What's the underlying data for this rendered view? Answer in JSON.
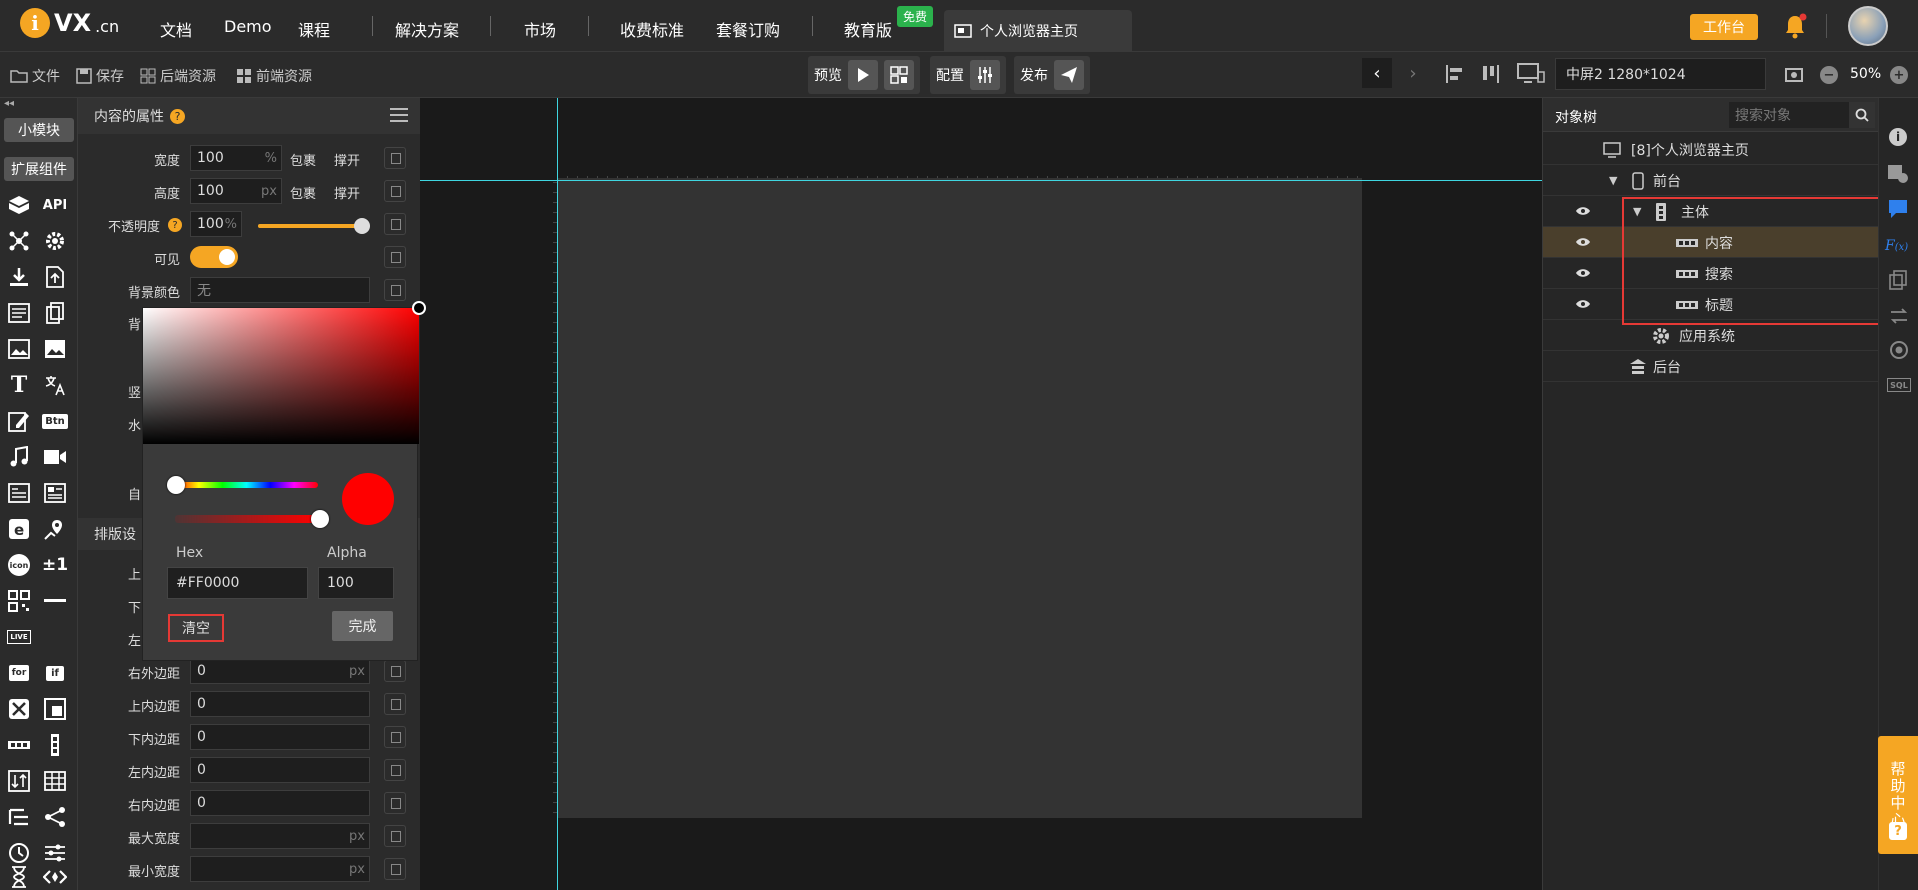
{
  "topbar": {
    "logo_i": "i",
    "logo_vx": "VX",
    "logo_cn": ".cn",
    "nav": [
      "文档",
      "Demo",
      "课程",
      "解决方案",
      "市场",
      "收费标准",
      "套餐订购",
      "教育版"
    ],
    "free_badge": "免费",
    "active_tab": "个人浏览器主页",
    "workbench": "工作台"
  },
  "toolbar": {
    "file": "文件",
    "save": "保存",
    "backend": "后端资源",
    "frontend": "前端资源",
    "preview": "预览",
    "config": "配置",
    "publish": "发布",
    "screen": "中屏2 1280*1024",
    "zoom": "50%"
  },
  "leftcol": {
    "small_module": "小模块",
    "extend": "扩展组件",
    "api": "API",
    "btn": "Btn",
    "icon": "icon",
    "plusminus": "±1",
    "live": "LIVE",
    "for": "for",
    "if": "if"
  },
  "props": {
    "title": "内容的属性",
    "width_label": "宽度",
    "width_value": "100",
    "width_unit": "%",
    "height_label": "高度",
    "height_value": "100",
    "height_unit": "px",
    "wrap": "包裹",
    "stretch": "撑开",
    "opacity_label": "不透明度",
    "opacity_value": "100",
    "opacity_unit": "%",
    "opacity_level": 1.0,
    "visible_label": "可见",
    "bgcolor_label": "背景颜色",
    "bgcolor_value": "无",
    "partial_bg": "背",
    "partial_vert": "竖",
    "partial_horiz": "水",
    "partial_custom": "自",
    "layout_section": "排版设",
    "partial_top": "上",
    "partial_bottom": "下",
    "partial_left": "左",
    "right_outer_label": "右外边距",
    "right_outer_value": "0",
    "px": "px",
    "top_inner_label": "上内边距",
    "top_inner_value": "0",
    "bottom_inner_label": "下内边距",
    "bottom_inner_value": "0",
    "left_inner_label": "左内边距",
    "left_inner_value": "0",
    "right_inner_label": "右内边距",
    "right_inner_value": "0",
    "max_width_label": "最大宽度",
    "min_width_label": "最小宽度"
  },
  "picker": {
    "hex_label": "Hex",
    "hex_value": "#FF0000",
    "alpha_label": "Alpha",
    "alpha_value": "100",
    "clear": "清空",
    "done": "完成",
    "color": "#FF0000"
  },
  "tree": {
    "tab": "对象树",
    "search_placeholder": "搜索对象",
    "root": "[8]个人浏览器主页",
    "front": "前台",
    "body": "主体",
    "content": "内容",
    "search": "搜索",
    "title": "标题",
    "app_system": "应用系统",
    "back": "后台"
  },
  "help": "帮助中心",
  "colors": {
    "accent": "#f5a623",
    "highlight": "#e53935",
    "guide": "#3fd6e0"
  }
}
